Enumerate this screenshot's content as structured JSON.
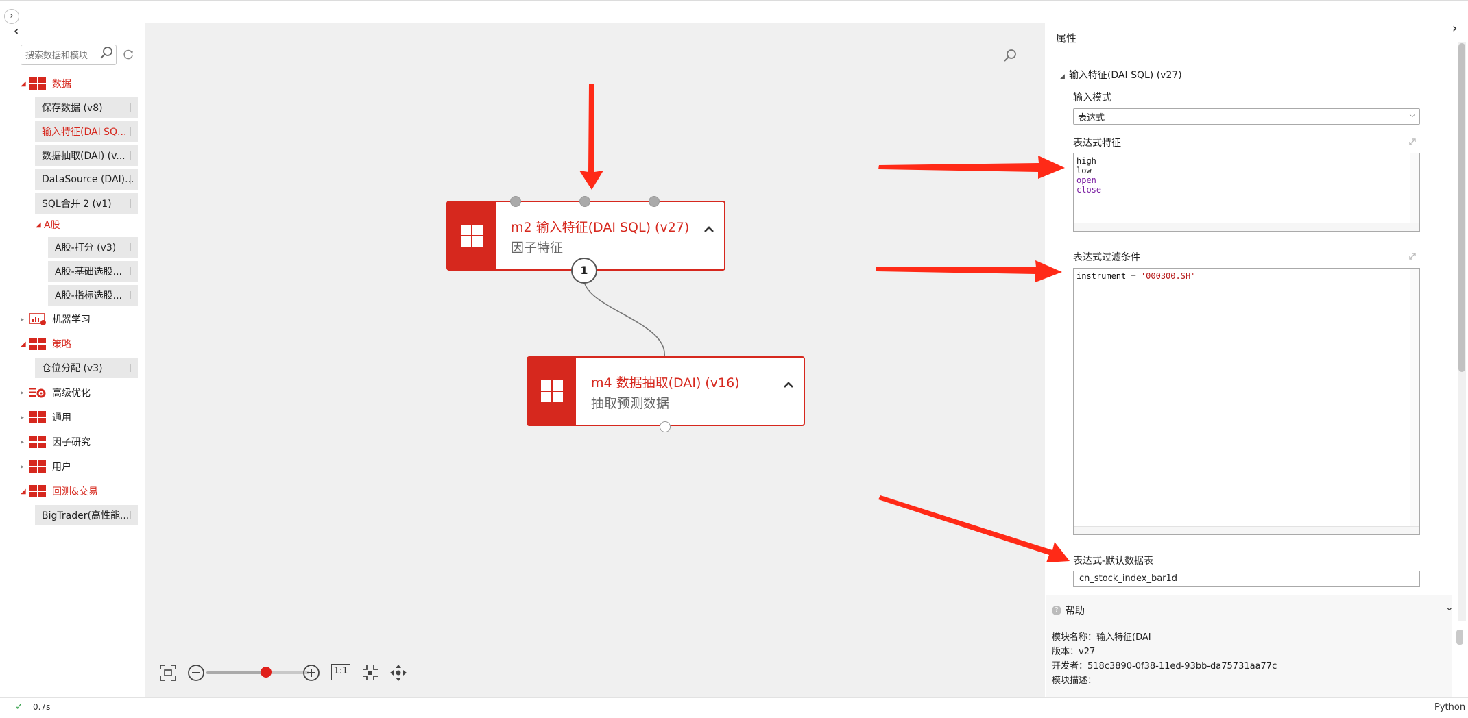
{
  "app": {
    "status_time": "0.7s",
    "language": "Python"
  },
  "sidebar": {
    "search_placeholder": "搜索数据和模块",
    "cat_data": "数据",
    "items_data": [
      "保存数据 (v8)",
      "输入特征(DAI SQ...",
      "数据抽取(DAI) (v...",
      "DataSource (DAI)...",
      "SQL合并 2 (v1)"
    ],
    "cat_a_share": "A股",
    "items_a_share": [
      "A股-打分 (v3)",
      "A股-基础选股...",
      "A股-指标选股..."
    ],
    "cat_ml": "机器学习",
    "cat_strategy": "策略",
    "items_strategy": [
      "仓位分配 (v3)"
    ],
    "cat_optim": "高级优化",
    "cat_general": "通用",
    "cat_factor": "因子研究",
    "cat_user": "用户",
    "cat_backtest": "回测&交易",
    "items_backtest": [
      "BigTrader(高性能..."
    ]
  },
  "canvas": {
    "node_m2": {
      "title": "m2 输入特征(DAI SQL) (v27)",
      "subtitle": "因子特征"
    },
    "node_m4": {
      "title": "m4 数据抽取(DAI) (v16)",
      "subtitle": "抽取预测数据"
    },
    "edge_badge": "1",
    "zoom": {
      "level": 0.58,
      "one_to_one": "1:1"
    }
  },
  "properties": {
    "title": "属性",
    "section": "输入特征(DAI SQL) (v27)",
    "input_mode_label": "输入模式",
    "input_mode_value": "表达式",
    "expr_label": "表达式特征",
    "expr_lines": [
      "high",
      "low",
      "open",
      "close"
    ],
    "filter_label": "表达式过滤条件",
    "filter_prefix": "instrument = ",
    "filter_value": "'000300.SH'",
    "default_table_label": "表达式-默认数据表",
    "default_table_value": "cn_stock_index_bar1d"
  },
  "help": {
    "title": "帮助",
    "module_name": "模块名称：输入特征(DAI",
    "version": "版本：v27",
    "developer": "开发者：518c3890-0f38-11ed-93bb-da75731aa77c",
    "description": "模块描述："
  },
  "colors": {
    "accent": "#d6281e",
    "annotation": "#ff2a17",
    "canvas_bg": "#f0f0f0"
  }
}
